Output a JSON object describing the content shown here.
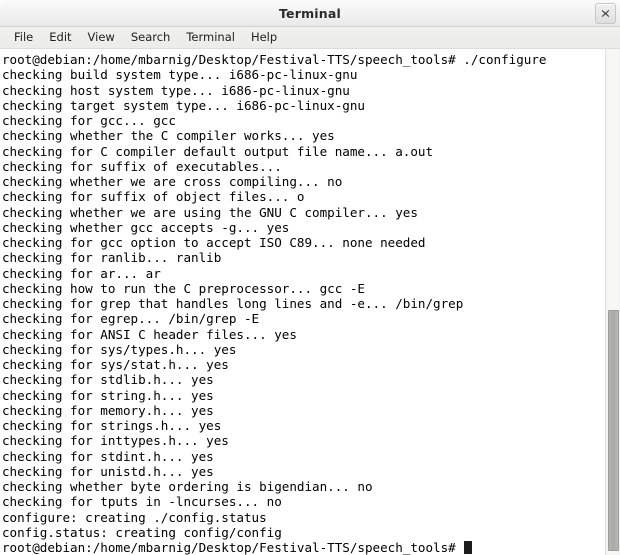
{
  "window": {
    "title": "Terminal",
    "close_label": "×"
  },
  "menubar": {
    "items": [
      {
        "label": "File"
      },
      {
        "label": "Edit"
      },
      {
        "label": "View"
      },
      {
        "label": "Search"
      },
      {
        "label": "Terminal"
      },
      {
        "label": "Help"
      }
    ]
  },
  "terminal": {
    "lines": [
      "root@debian:/home/mbarnig/Desktop/Festival-TTS/speech_tools# ./configure",
      "checking build system type... i686-pc-linux-gnu",
      "checking host system type... i686-pc-linux-gnu",
      "checking target system type... i686-pc-linux-gnu",
      "checking for gcc... gcc",
      "checking whether the C compiler works... yes",
      "checking for C compiler default output file name... a.out",
      "checking for suffix of executables...",
      "checking whether we are cross compiling... no",
      "checking for suffix of object files... o",
      "checking whether we are using the GNU C compiler... yes",
      "checking whether gcc accepts -g... yes",
      "checking for gcc option to accept ISO C89... none needed",
      "checking for ranlib... ranlib",
      "checking for ar... ar",
      "checking how to run the C preprocessor... gcc -E",
      "checking for grep that handles long lines and -e... /bin/grep",
      "checking for egrep... /bin/grep -E",
      "checking for ANSI C header files... yes",
      "checking for sys/types.h... yes",
      "checking for sys/stat.h... yes",
      "checking for stdlib.h... yes",
      "checking for string.h... yes",
      "checking for memory.h... yes",
      "checking for strings.h... yes",
      "checking for inttypes.h... yes",
      "checking for stdint.h... yes",
      "checking for unistd.h... yes",
      "checking whether byte ordering is bigendian... no",
      "checking for tputs in -lncurses... no",
      "configure: creating ./config.status",
      "config.status: creating config/config"
    ],
    "prompt": "root@debian:/home/mbarnig/Desktop/Festival-TTS/speech_tools# ",
    "colors": {
      "background": "#ffffff",
      "foreground": "#000000",
      "cursor": "#1c1c1c"
    }
  },
  "scrollbar": {
    "orientation": "vertical"
  }
}
